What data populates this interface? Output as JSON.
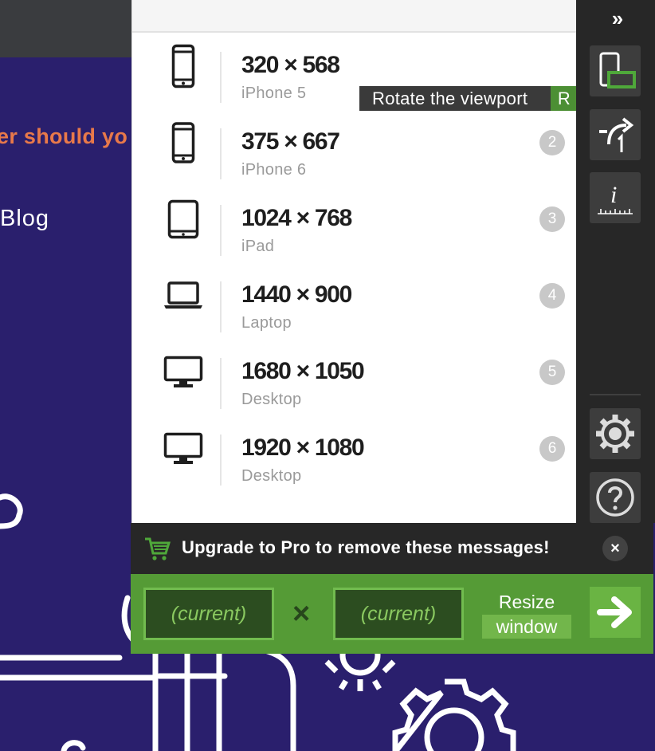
{
  "background": {
    "heading_fragment": "er should yo",
    "nav_link": "Blog"
  },
  "tooltip": {
    "text": "Rotate the viewport",
    "shortcut": "R"
  },
  "devices": [
    {
      "size": "320 × 568",
      "name": "iPhone 5",
      "icon": "phone-icon",
      "key": "1"
    },
    {
      "size": "375 × 667",
      "name": "iPhone 6",
      "icon": "phone-icon",
      "key": "2"
    },
    {
      "size": "1024 × 768",
      "name": "iPad",
      "icon": "tablet-icon",
      "key": "3"
    },
    {
      "size": "1440 × 900",
      "name": "Laptop",
      "icon": "laptop-icon",
      "key": "4"
    },
    {
      "size": "1680 × 1050",
      "name": "Desktop",
      "icon": "desktop-icon",
      "key": "5"
    },
    {
      "size": "1920 × 1080",
      "name": "Desktop",
      "icon": "desktop-icon",
      "key": "6"
    }
  ],
  "sidebar": {
    "collapse_label": "»",
    "buttons": [
      "rotate-viewport-icon",
      "open-url-icon",
      "page-info-ruler-icon",
      "settings-gear-icon",
      "help-icon"
    ]
  },
  "upgrade": {
    "message": "Upgrade to Pro to remove these messages!",
    "close_label": "×"
  },
  "resize": {
    "width_placeholder": "(current)",
    "height_placeholder": "(current)",
    "times_symbol": "×",
    "label_line1": "Resize",
    "label_line2": "window"
  },
  "colors": {
    "accent_green": "#559b36",
    "background_page": "#2a1f6d",
    "heading_orange": "#e8794a",
    "sidebar_dark": "#272727"
  }
}
